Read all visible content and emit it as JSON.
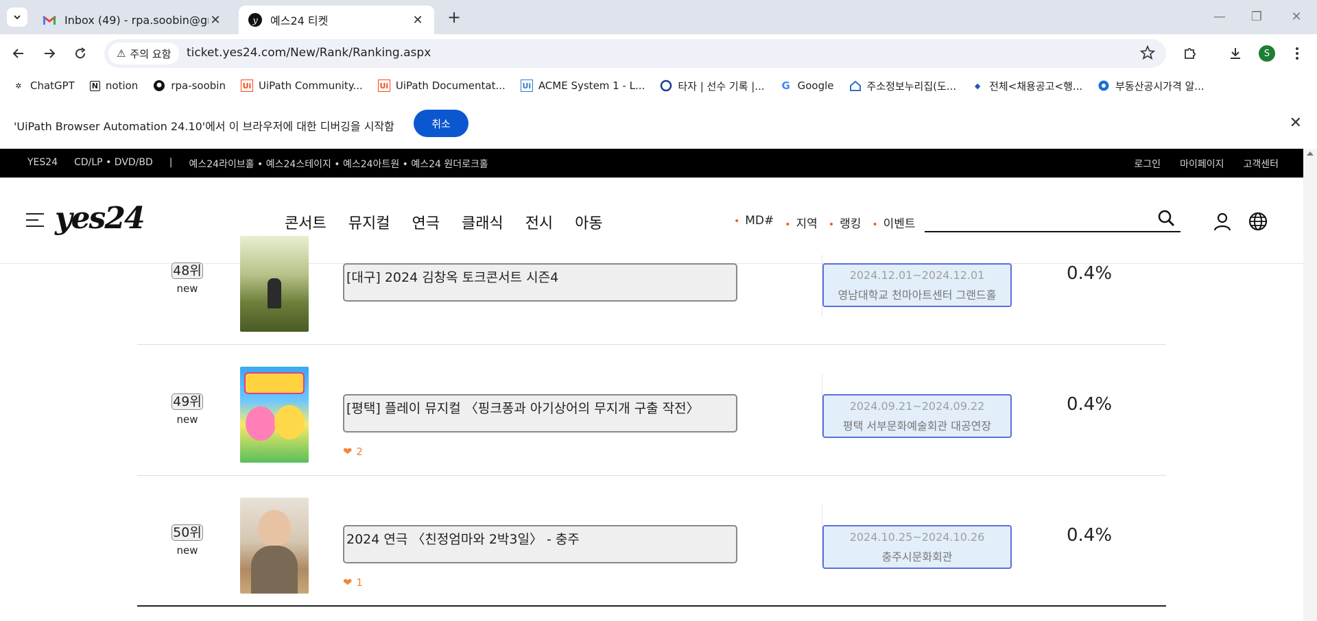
{
  "browser": {
    "tabs": [
      {
        "title": "Inbox (49) - rpa.soobin@gmail.",
        "active": false
      },
      {
        "title": "예스24 티켓",
        "active": true
      }
    ],
    "security_chip": "주의 요함",
    "url": "ticket.yes24.com/New/Rank/Ranking.aspx",
    "profile_initial": "S",
    "bookmarks": [
      {
        "label": "ChatGPT",
        "icon": "chatgpt-icon"
      },
      {
        "label": "notion",
        "icon": "notion-icon"
      },
      {
        "label": "rpa-soobin",
        "icon": "github-icon"
      },
      {
        "label": "UiPath Community...",
        "icon": "uipath-icon"
      },
      {
        "label": "UiPath Documentat...",
        "icon": "uipath-icon"
      },
      {
        "label": "ACME System 1 - L...",
        "icon": "uipath-icon"
      },
      {
        "label": "타자 | 선수 기록 |...",
        "icon": "kbo-icon"
      },
      {
        "label": "Google",
        "icon": "google-icon"
      },
      {
        "label": "주소정보누리집(도...",
        "icon": "juso-icon"
      },
      {
        "label": "전체<채용공고<행...",
        "icon": "job-icon"
      },
      {
        "label": "부동산공시가격 알...",
        "icon": "realty-icon"
      }
    ],
    "infobar": {
      "message": "'UiPath Browser Automation 24.10'에서 이 브라우저에 대한 디버깅을 시작함",
      "cancel_label": "취소"
    }
  },
  "site": {
    "topbar": {
      "left": [
        "YES24",
        "CD/LP • DVD/BD",
        "|",
        "예스24라이브홀 • 예스24스테이지 • 예스24아트원 • 예스24 원더로크홀"
      ],
      "right": [
        "로그인",
        "마이페이지",
        "고객센터"
      ]
    },
    "logo": "yes24",
    "main_nav": [
      "콘서트",
      "뮤지컬",
      "연극",
      "클래식",
      "전시",
      "아동"
    ],
    "sub_nav": [
      "MD#",
      "지역",
      "랭킹",
      "이벤트"
    ]
  },
  "ranking": [
    {
      "rank": "48위",
      "change": "new",
      "title": "[대구] 2024 김창옥 토크콘서트 시즌4",
      "likes": "",
      "date": "2024.12.01~2024.12.01",
      "place": "영남대학교 천마아트센터 그랜드홀",
      "share": "0.4%"
    },
    {
      "rank": "49위",
      "change": "new",
      "title": "[평택] 플레이 뮤지컬 〈핑크퐁과 아기상어의 무지개 구출 작전〉",
      "likes": "2",
      "date": "2024.09.21~2024.09.22",
      "place": "평택 서부문화예술회관 대공연장",
      "share": "0.4%"
    },
    {
      "rank": "50위",
      "change": "new",
      "title": "2024 연극 〈친정엄마와 2박3일〉 - 충주",
      "likes": "1",
      "date": "2024.10.25~2024.10.26",
      "place": "충주시문화회관",
      "share": "0.4%"
    }
  ]
}
